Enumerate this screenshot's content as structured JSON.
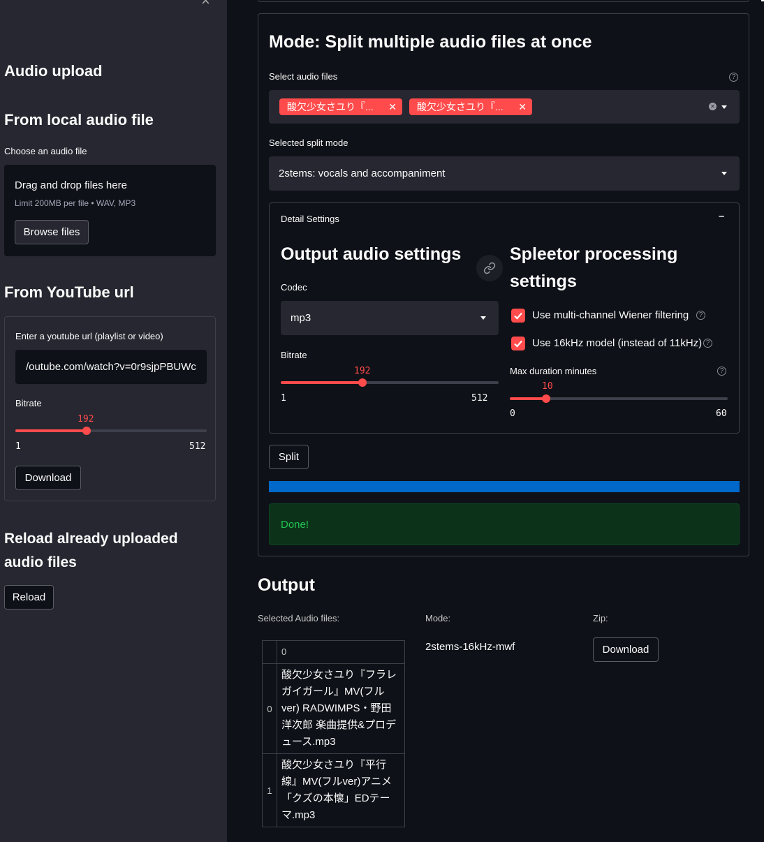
{
  "sidebar": {
    "close_icon": "×",
    "audio_upload_title": "Audio upload",
    "local_title": "From local audio file",
    "choose_label": "Choose an audio file",
    "dropzone_text": "Drag and drop files here",
    "dropzone_limit": "Limit 200MB per file • WAV, MP3",
    "browse_label": "Browse files",
    "youtube_title": "From YouTube url",
    "youtube_label": "Enter a youtube url (playlist or video)",
    "youtube_value": "/outube.com/watch?v=0r9sjpPBUWc",
    "bitrate_label": "Bitrate",
    "bitrate": {
      "value": 192,
      "min": 1,
      "max": 512
    },
    "download_label": "Download",
    "reload_title_line1": "Reload already uploaded",
    "reload_title_line2": "audio files",
    "reload_label": "Reload"
  },
  "main": {
    "mode_title": "Mode: Split multiple audio files at once",
    "select_files_label": "Select audio files",
    "selected_files": [
      "酸欠少女さユり『...",
      "酸欠少女さユり『..."
    ],
    "split_mode_label": "Selected split mode",
    "split_mode_value": "2stems: vocals and accompaniment",
    "detail_settings_label": "Detail Settings",
    "collapse_symbol": "–",
    "output_settings_title": "Output audio settings",
    "codec_label": "Codec",
    "codec_value": "mp3",
    "bitrate_label": "Bitrate",
    "bitrate": {
      "value": 192,
      "min": 1,
      "max": 512
    },
    "spleeter_title_line1": "Spleetor processing",
    "spleeter_title_line2": "settings",
    "wiener_label": "Use multi-channel Wiener filtering",
    "wiener_checked": true,
    "model16k_label": "Use 16kHz model (instead of 11kHz)",
    "model16k_checked": true,
    "max_duration_label": "Max duration minutes",
    "max_duration": {
      "value": 10,
      "min": 0,
      "max": 60
    },
    "split_label": "Split",
    "progress": 1.0,
    "done_text": "Done!",
    "output_title": "Output",
    "selected_audio_label": "Selected Audio files:",
    "mode_label": "Mode:",
    "mode_value": "2stems-16kHz-mwf",
    "zip_label": "Zip:",
    "zip_download_label": "Download",
    "table": {
      "column": "0",
      "rows": [
        {
          "index": "0",
          "value": "酸欠少女さユり『フラレガイガール』MV(フルver) RADWIMPS・野田洋次郎 楽曲提供&プロデュース.mp3"
        },
        {
          "index": "1",
          "value": "酸欠少女さユり『平行線』MV(フルver)アニメ「クズの本懐」EDテーマ.mp3"
        }
      ]
    }
  },
  "colors": {
    "accent": "#ff4b4b",
    "progress": "#0068c9",
    "success_bg": "#0c3319",
    "success_text": "#21c354",
    "sidebar_bg": "#262730",
    "main_bg": "#0e1117"
  }
}
